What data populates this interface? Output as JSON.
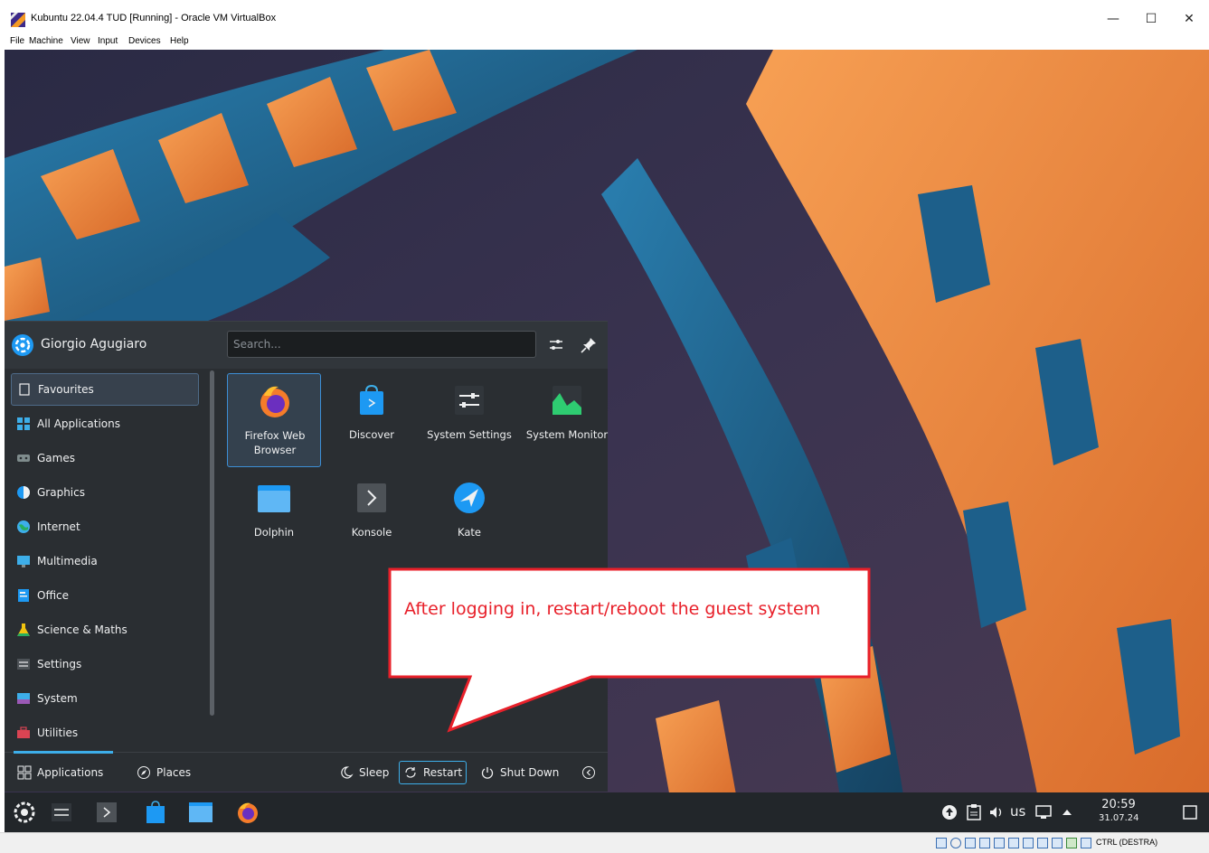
{
  "window": {
    "title": "Kubuntu 22.04.4 TUD [Running] - Oracle VM VirtualBox",
    "controls": {
      "minimize": "—",
      "maximize": "☐",
      "close": "✕"
    }
  },
  "menubar": [
    "File",
    "Machine",
    "View",
    "Input",
    "Devices",
    "Help"
  ],
  "launcher": {
    "user_name": "Giorgio Agugiaro",
    "search_placeholder": "Search...",
    "categories": [
      {
        "label": "Favourites",
        "icon": "bookmark-icon"
      },
      {
        "label": "All Applications",
        "icon": "grid-icon"
      },
      {
        "label": "Games",
        "icon": "gamepad-icon"
      },
      {
        "label": "Graphics",
        "icon": "graphics-icon"
      },
      {
        "label": "Internet",
        "icon": "globe-icon"
      },
      {
        "label": "Multimedia",
        "icon": "multimedia-icon"
      },
      {
        "label": "Office",
        "icon": "office-icon"
      },
      {
        "label": "Science & Maths",
        "icon": "flask-icon"
      },
      {
        "label": "Settings",
        "icon": "settings-icon"
      },
      {
        "label": "System",
        "icon": "system-icon"
      },
      {
        "label": "Utilities",
        "icon": "toolbox-icon"
      }
    ],
    "apps": [
      {
        "label": "Firefox Web Browser",
        "icon": "firefox-icon"
      },
      {
        "label": "Discover",
        "icon": "discover-bag-icon"
      },
      {
        "label": "System Settings",
        "icon": "system-settings-icon"
      },
      {
        "label": "System Monitor",
        "icon": "system-monitor-icon"
      },
      {
        "label": "Dolphin",
        "icon": "folder-icon"
      },
      {
        "label": "Konsole",
        "icon": "terminal-icon"
      },
      {
        "label": "Kate",
        "icon": "kate-icon"
      }
    ],
    "footer": {
      "applications": "Applications",
      "places": "Places",
      "sleep": "Sleep",
      "restart": "Restart",
      "shutdown": "Shut Down"
    }
  },
  "panel": {
    "keyboard_layout": "us",
    "time": "20:59",
    "date": "31.07.24"
  },
  "callout": {
    "text": "After logging in, restart/reboot the guest system"
  },
  "statusbar": {
    "host_key": "CTRL (DESTRA)"
  },
  "colors": {
    "accent": "#3daee9",
    "callout_border": "#e8202a",
    "panel": "#22262a",
    "launcher": "#2a2e32"
  }
}
